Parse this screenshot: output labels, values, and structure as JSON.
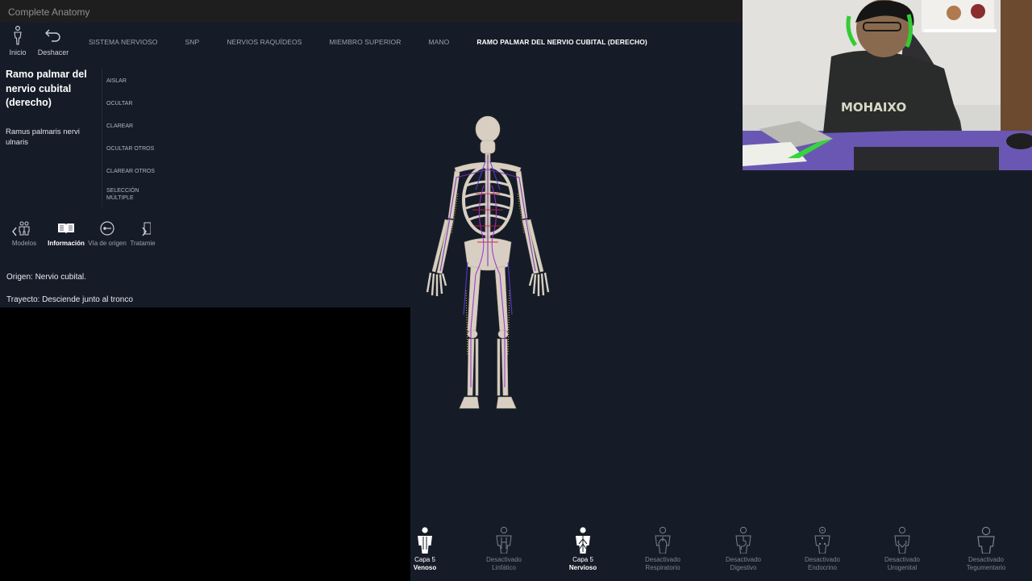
{
  "app": {
    "title": "Complete Anatomy"
  },
  "toolbar": {
    "home_label": "Inicio",
    "undo_label": "Deshacer"
  },
  "breadcrumb": [
    "SISTEMA NERVIOSO",
    "SNP",
    "NERVIOS RAQUÍDEOS",
    "MIEMBRO SUPERIOR",
    "MANO",
    "RAMO PALMAR DEL NERVIO CUBITAL (DERECHO)"
  ],
  "info": {
    "title": "Ramo palmar del nervio cubital (derecho)",
    "latin": "Ramus palmaris nervi ulnaris",
    "origin": "Origen: Nervio cubital.",
    "course": "Trayecto: Desciende junto al tronco"
  },
  "actions": [
    "AISLAR",
    "OCULTAR",
    "CLAREAR",
    "OCULTAR OTROS",
    "CLAREAR OTROS",
    "SELECCIÓN MÚLTIPLE"
  ],
  "tabs": [
    {
      "label": "Modelos",
      "icon": "models-icon"
    },
    {
      "label": "Información",
      "icon": "book-icon"
    },
    {
      "label": "Vía de origen",
      "icon": "pathway-icon"
    },
    {
      "label": "Tratamie",
      "icon": "treatment-icon"
    }
  ],
  "layers": [
    {
      "state": "Capa 5",
      "name": "Venoso",
      "on": true
    },
    {
      "state": "Desactivado",
      "name": "Linfático",
      "on": false
    },
    {
      "state": "Capa 5",
      "name": "Nervioso",
      "on": true
    },
    {
      "state": "Desactivado",
      "name": "Respiratorio",
      "on": false
    },
    {
      "state": "Desactivado",
      "name": "Digestivo",
      "on": false
    },
    {
      "state": "Desactivado",
      "name": "Endocrino",
      "on": false
    },
    {
      "state": "Desactivado",
      "name": "Urogenital",
      "on": false
    },
    {
      "state": "Desactivado",
      "name": "Tegumentario",
      "on": false
    }
  ],
  "colors": {
    "background": "#161c27",
    "titlebar": "#1e1e1f",
    "active_text": "#ffffff",
    "inactive_text": "#7a8292"
  }
}
